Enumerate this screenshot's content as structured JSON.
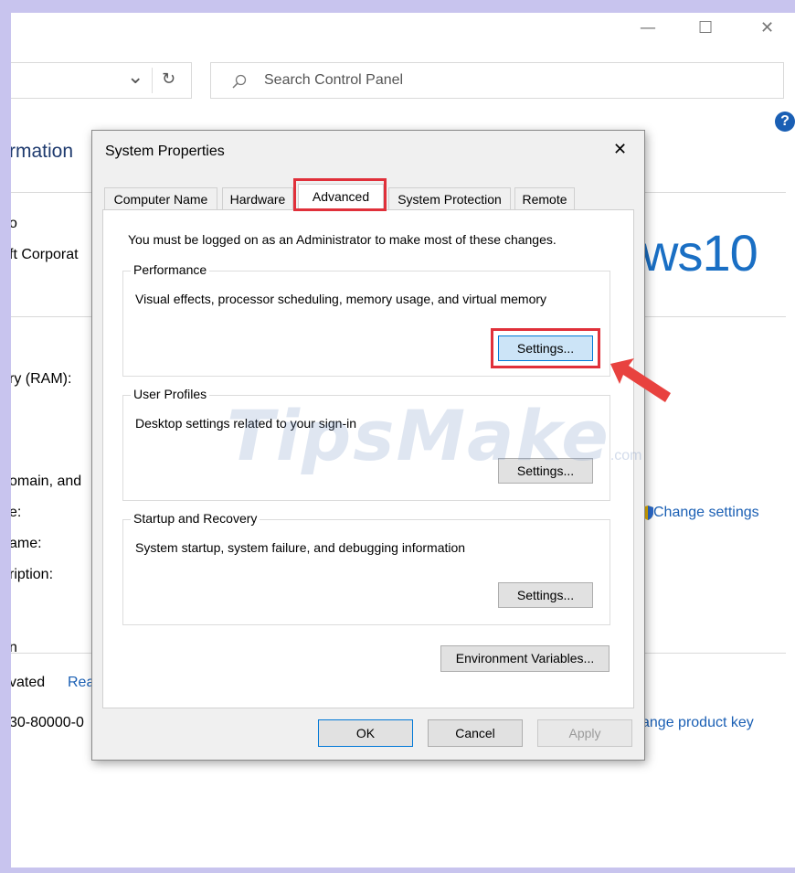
{
  "background_window": {
    "title_controls": {
      "minimize": "—",
      "maximize": "☐",
      "close": "✕"
    },
    "address": {
      "dropdown_glyph": "⌄",
      "refresh_glyph": "↻"
    },
    "search": {
      "placeholder": "Search Control Panel"
    },
    "help_glyph": "?",
    "section_title": "rmation",
    "labels": [
      "o",
      "ft Corporat",
      "ry (RAM):",
      "omain, and",
      "e:",
      "ame:",
      "ription:",
      "n",
      "vated",
      "30-80000-0"
    ],
    "activation_link": "Rea",
    "windows_brand": "ws10",
    "change_settings_link": "Change settings",
    "change_product_key_link": "ange product key"
  },
  "dialog": {
    "title": "System Properties",
    "close_glyph": "✕",
    "tabs": [
      "Computer Name",
      "Hardware",
      "Advanced",
      "System Protection",
      "Remote"
    ],
    "active_tab": "Advanced",
    "admin_notice": "You must be logged on as an Administrator to make most of these changes.",
    "groups": {
      "performance": {
        "title": "Performance",
        "description": "Visual effects, processor scheduling, memory usage, and virtual memory",
        "button": "Settings..."
      },
      "user_profiles": {
        "title": "User Profiles",
        "description": "Desktop settings related to your sign-in",
        "button": "Settings..."
      },
      "startup_recovery": {
        "title": "Startup and Recovery",
        "description": "System startup, system failure, and debugging information",
        "button": "Settings..."
      }
    },
    "env_button": "Environment Variables...",
    "ok_button": "OK",
    "cancel_button": "Cancel",
    "apply_button": "Apply"
  },
  "watermark": {
    "text": "TipsMake",
    "suffix": ".com"
  },
  "colors": {
    "highlight": "#e0303a",
    "arrow": "#e8423f",
    "link": "#1a5fb4",
    "focus_button": "#cce4f7"
  }
}
